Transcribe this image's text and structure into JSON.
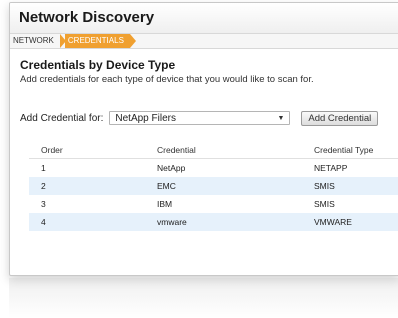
{
  "header": {
    "title": "Network Discovery"
  },
  "breadcrumb": {
    "items": [
      "NETWORK",
      "CREDENTIALS"
    ]
  },
  "section": {
    "title": "Credentials by Device Type",
    "description": "Add credentials for each type of device that you would like to scan for."
  },
  "add_credential": {
    "label": "Add Credential for:",
    "selected": "NetApp Filers",
    "button_label": "Add Credential"
  },
  "table": {
    "columns": [
      "Order",
      "Credential",
      "Credential Type"
    ],
    "rows": [
      {
        "order": "1",
        "credential": "NetApp",
        "type": "NETAPP"
      },
      {
        "order": "2",
        "credential": "EMC",
        "type": "SMIS"
      },
      {
        "order": "3",
        "credential": "IBM",
        "type": "SMIS"
      },
      {
        "order": "4",
        "credential": "vmware",
        "type": "VMWARE"
      }
    ]
  },
  "colors": {
    "accent": "#f0a030",
    "row_alt": "#e6f1fb"
  }
}
